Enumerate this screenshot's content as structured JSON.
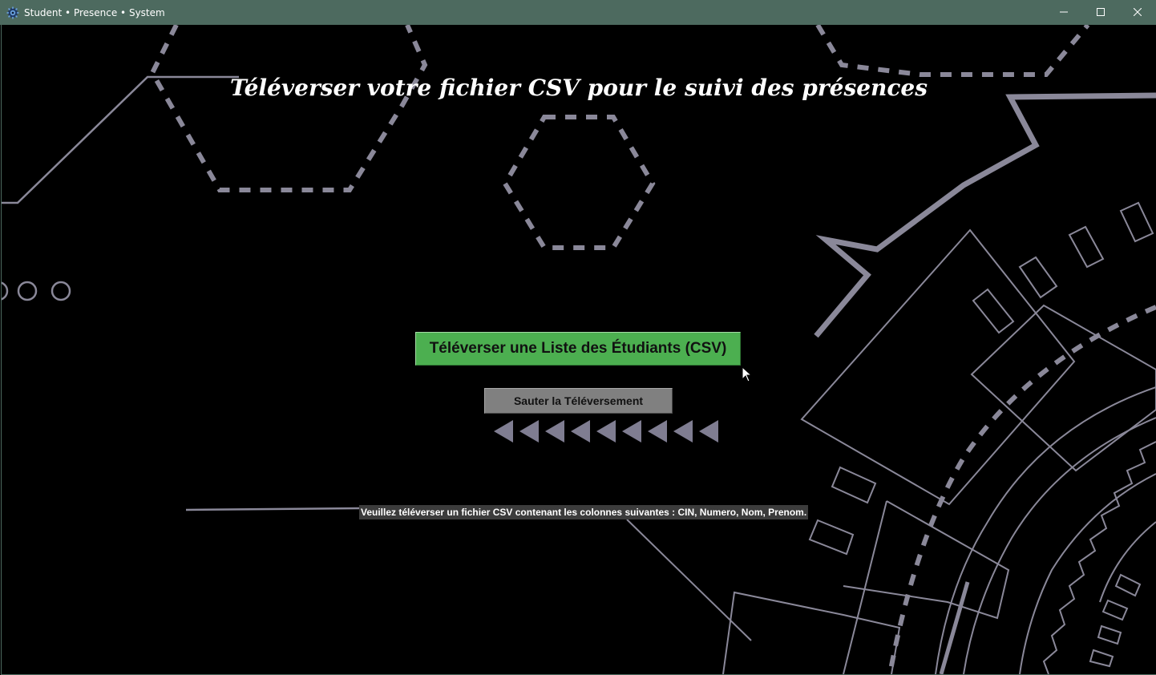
{
  "window": {
    "title": "Student • Presence • System",
    "app_icon": "gear-cog-icon",
    "controls": {
      "minimize_icon": "minimize-icon",
      "maximize_icon": "maximize-icon",
      "close_icon": "close-icon"
    },
    "titlebar_color": "#4d6a5f"
  },
  "main": {
    "heading": "Téléverser votre fichier CSV pour le suivi des présences",
    "upload_button_label": "Téléverser une Liste des Étudiants (CSV)",
    "upload_button_color": "#4caf50",
    "skip_button_label": "Sauter la Téléversement",
    "skip_button_color": "#808080",
    "arrow_icon": "triangle-left-icon",
    "instructions": "Veuillez téléverser un fichier CSV contenant les colonnes suivantes : CIN, Numero, Nom, Prenom."
  },
  "background": {
    "color": "#000000",
    "line_color": "#8a8899"
  }
}
